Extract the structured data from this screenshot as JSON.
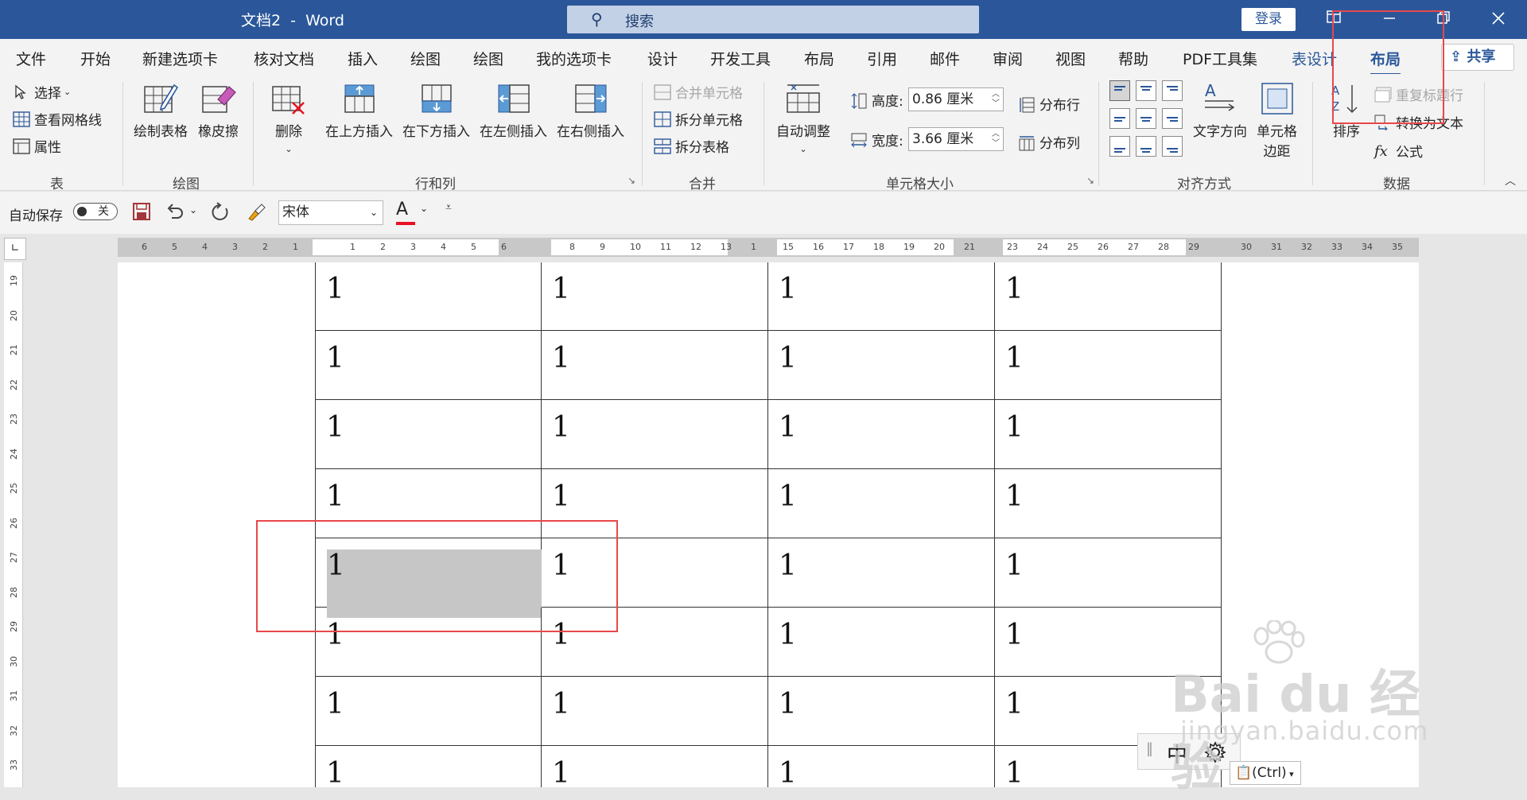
{
  "titlebar": {
    "document_name": "文档2  -  Word",
    "search_placeholder": "搜索",
    "login_label": "登录",
    "window_controls": [
      "ribbon-display-icon",
      "minimize-icon",
      "restore-icon",
      "close-icon"
    ]
  },
  "ribbon_tabs": [
    "文件",
    "开始",
    "新建选项卡",
    "核对文档",
    "插入",
    "绘图",
    "绘图",
    "我的选项卡",
    "设计",
    "开发工具",
    "布局",
    "引用",
    "邮件",
    "审阅",
    "视图",
    "帮助",
    "PDF工具集",
    "表设计",
    "布局"
  ],
  "active_tab": "布局",
  "share_label": "共享",
  "ribbon": {
    "table_group": {
      "label": "表",
      "select": "选择",
      "view_gridlines": "查看网格线",
      "properties": "属性"
    },
    "draw_group": {
      "label": "绘图",
      "draw_table": "绘制表格",
      "eraser": "橡皮擦"
    },
    "rows_cols_group": {
      "label": "行和列",
      "delete": "删除",
      "insert_above": "在上方插入",
      "insert_below": "在下方插入",
      "insert_left": "在左侧插入",
      "insert_right": "在右侧插入"
    },
    "merge_group": {
      "label": "合并",
      "merge_cells": "合并单元格",
      "split_cells": "拆分单元格",
      "split_table": "拆分表格"
    },
    "cell_size_group": {
      "label": "单元格大小",
      "autofit": "自动调整",
      "height_label": "高度:",
      "height_value": "0.86 厘米",
      "width_label": "宽度:",
      "width_value": "3.66 厘米",
      "distribute_rows": "分布行",
      "distribute_cols": "分布列"
    },
    "alignment_group": {
      "label": "对齐方式",
      "text_direction": "文字方向",
      "cell_margins_1": "单元格",
      "cell_margins_2": "边距"
    },
    "data_group": {
      "label": "数据",
      "sort": "排序",
      "repeat_header": "重复标题行",
      "convert_to_text": "转换为文本",
      "formula": "公式"
    }
  },
  "qat": {
    "autosave_label": "自动保存",
    "autosave_state": "关",
    "font_name": "宋体",
    "font_color_letter": "A",
    "font_color": "#e81123"
  },
  "ruler": {
    "h_left_numbers": [
      "6",
      "5",
      "4",
      "3",
      "2",
      "1"
    ],
    "h_col1": [
      "1",
      "2",
      "3",
      "4",
      "5",
      "6"
    ],
    "h_col2": [
      "8",
      "9",
      "10",
      "11",
      "12",
      "13",
      "1"
    ],
    "h_col3": [
      "15",
      "16",
      "17",
      "18",
      "19",
      "20",
      "21"
    ],
    "h_col4": [
      "23",
      "24",
      "25",
      "26",
      "27",
      "28",
      "29"
    ],
    "h_right": [
      "30",
      "31",
      "32",
      "33",
      "34",
      "35"
    ],
    "v_numbers": [
      "19",
      "20",
      "21",
      "22",
      "23",
      "24",
      "25",
      "26",
      "27",
      "28",
      "29",
      "30",
      "31",
      "32",
      "33"
    ]
  },
  "table": {
    "rows": [
      [
        "1",
        "1",
        "1",
        "1"
      ],
      [
        "1",
        "1",
        "1",
        "1"
      ],
      [
        "1",
        "1",
        "1",
        "1"
      ],
      [
        "1",
        "1",
        "1",
        "1"
      ],
      [
        "1",
        "1",
        "1",
        "1"
      ],
      [
        "1",
        "1",
        "1",
        "1"
      ],
      [
        "1",
        "1",
        "1",
        "1"
      ],
      [
        "1",
        "1",
        "1",
        "1"
      ]
    ],
    "highlighted_row": 4,
    "highlighted_col": 0
  },
  "ime": {
    "language": "中",
    "settings_icon": "gear-icon"
  },
  "paste_options_label": "(Ctrl)",
  "watermark": {
    "brand": "Bai du 经验",
    "url": "jingyan.baidu.com"
  },
  "colors": {
    "accent": "#2b579a",
    "annotation": "#e8484a"
  }
}
